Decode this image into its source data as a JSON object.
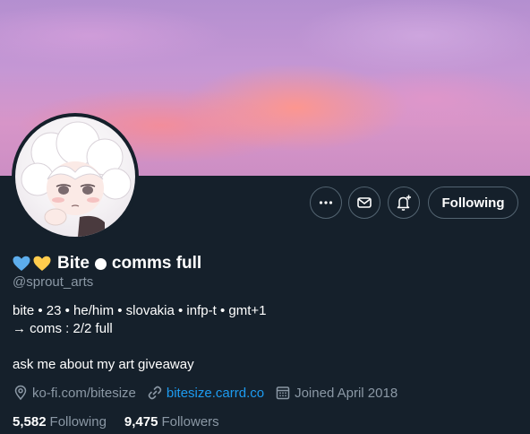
{
  "profile": {
    "display_name": "Bite",
    "display_name_suffix": "comms full",
    "handle": "@sprout_arts",
    "bio_lines": [
      "bite • 23 • he/him • slovakia • infp-t • gmt+1",
      "→ coms : 2/2 full",
      "",
      "ask me about my art giveaway"
    ],
    "location": "ko-fi.com/bitesize",
    "website": "bitesize.carrd.co",
    "joined": "Joined April 2018",
    "following_count": "5,582",
    "following_label": "Following",
    "followers_count": "9,475",
    "followers_label": "Followers"
  },
  "actions": {
    "more_icon": "more-icon",
    "message_icon": "envelope-icon",
    "notify_icon": "bell-plus-icon",
    "follow_label": "Following"
  },
  "icons": {
    "location": "location-pin-icon",
    "website": "link-icon",
    "joined": "calendar-icon"
  },
  "colors": {
    "background": "#15202b",
    "secondary_text": "#8b98a5",
    "link": "#1d9bf0",
    "border": "#536471",
    "heart_blue": "#5dadec",
    "heart_yellow": "#ffcc4d"
  }
}
